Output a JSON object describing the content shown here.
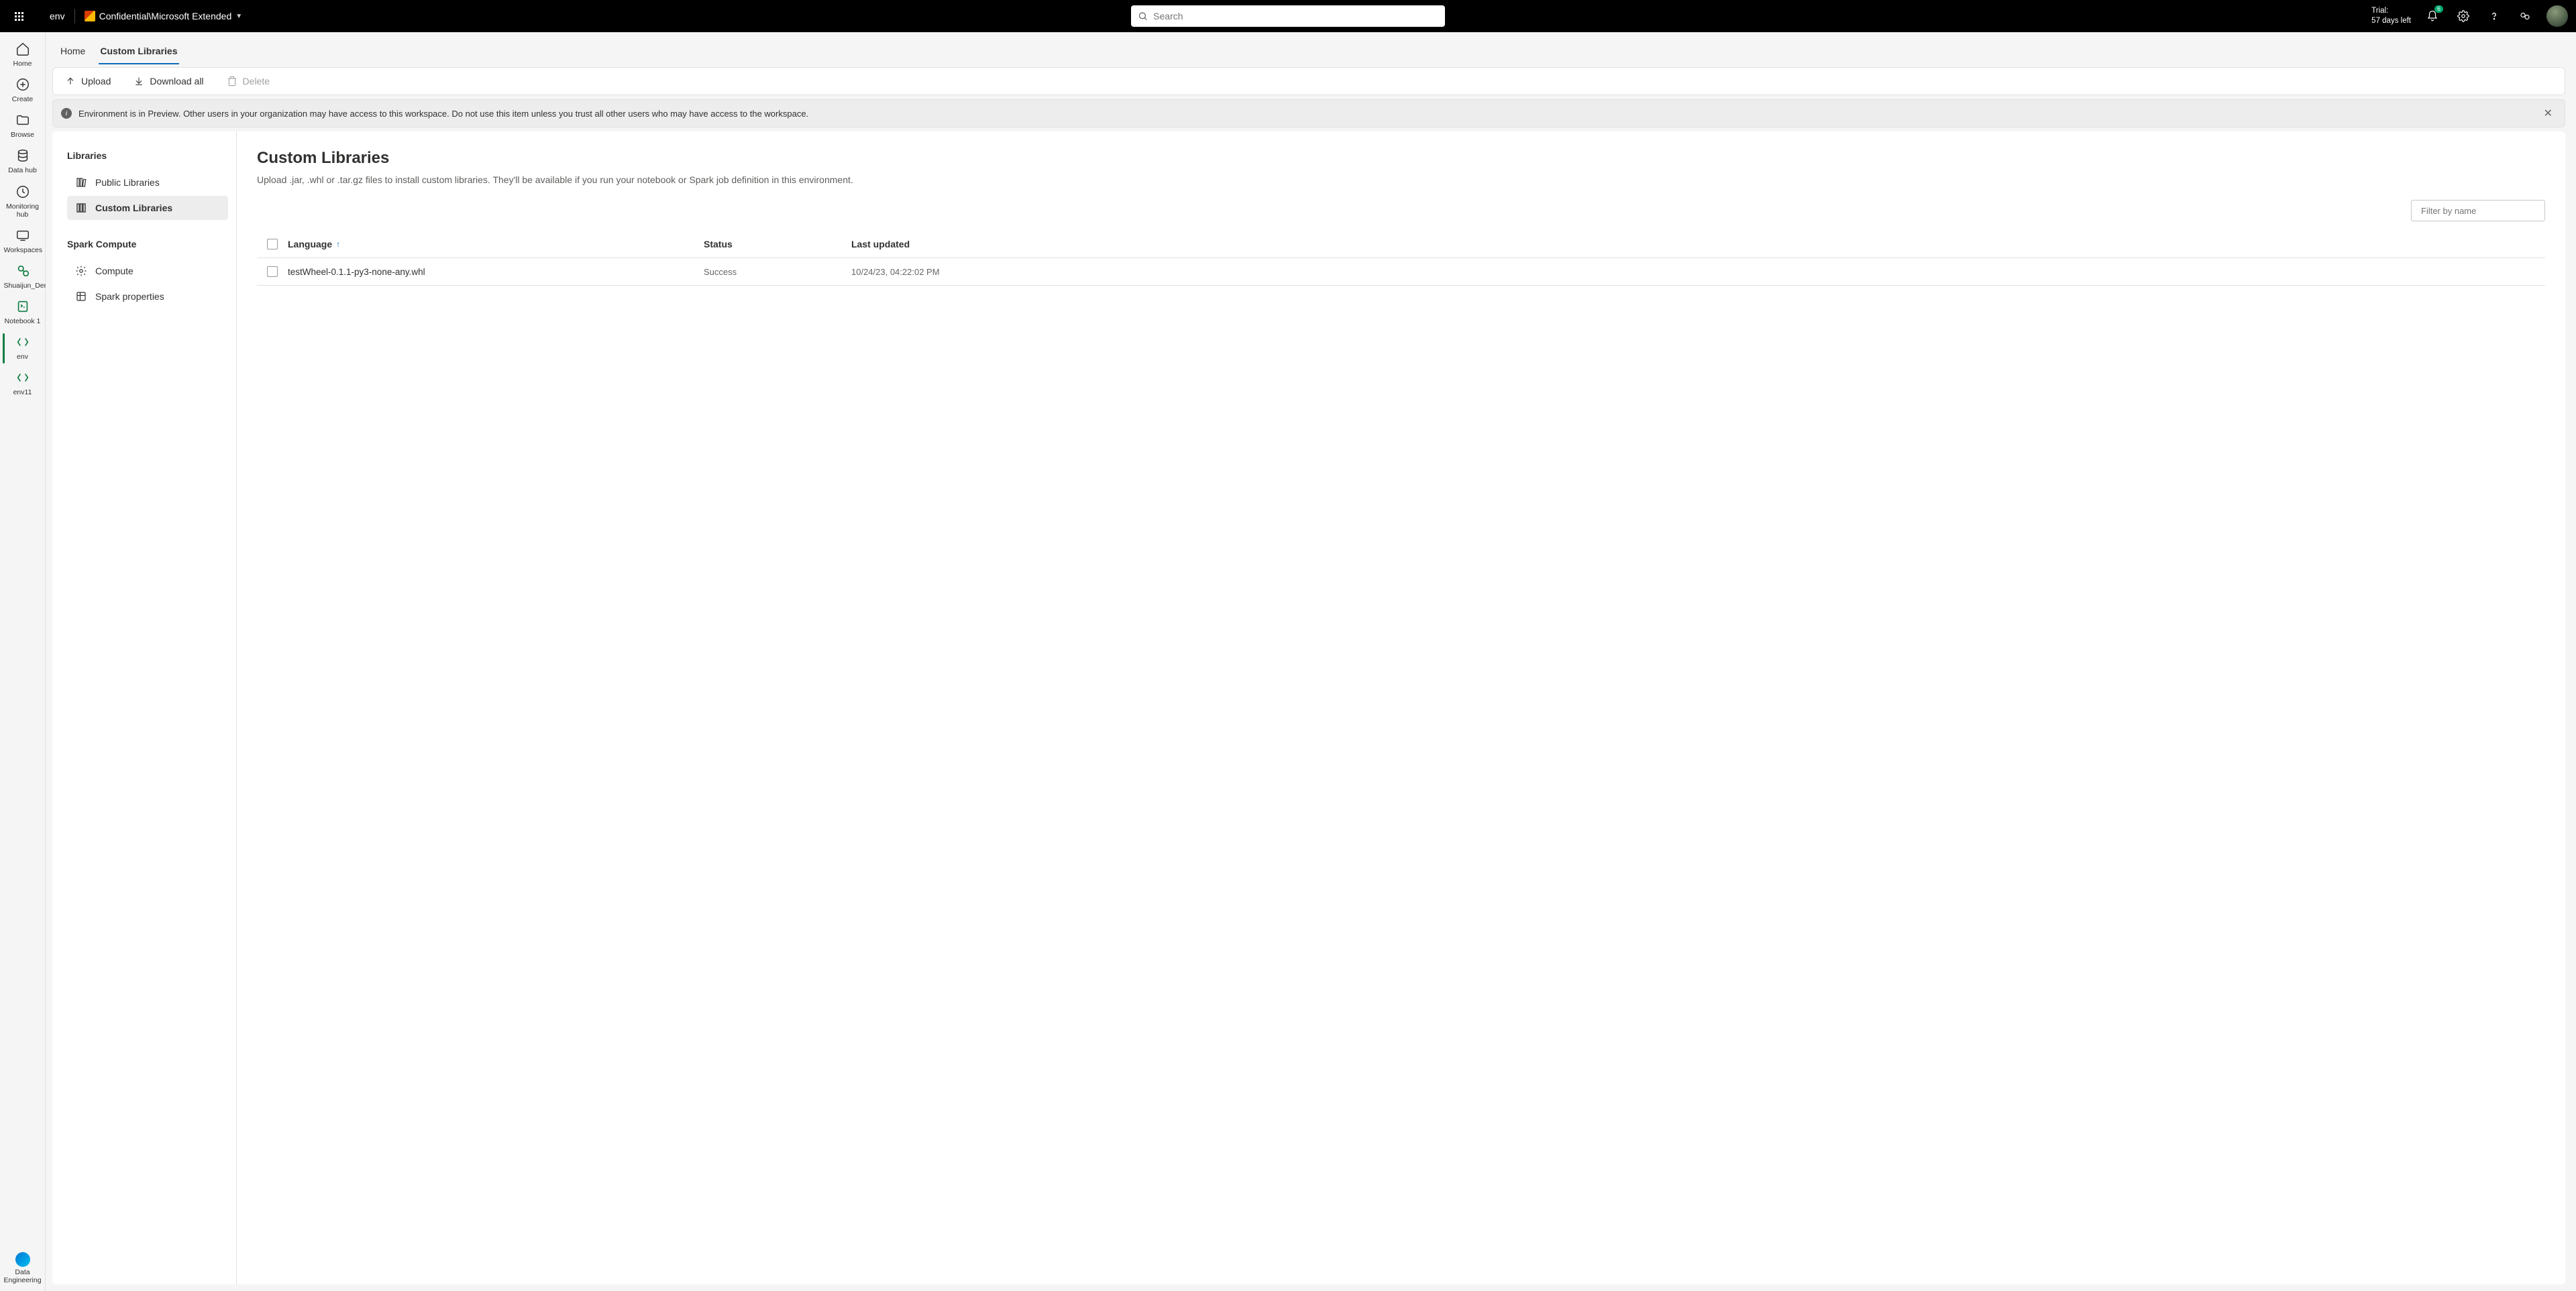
{
  "topbar": {
    "title": "env",
    "sensitivity": "Confidential\\Microsoft Extended",
    "search_placeholder": "Search",
    "trial_label": "Trial:",
    "trial_remaining": "57 days left",
    "notification_count": "6"
  },
  "navrail": {
    "items": [
      {
        "label": "Home"
      },
      {
        "label": "Create"
      },
      {
        "label": "Browse"
      },
      {
        "label": "Data hub"
      },
      {
        "label": "Monitoring hub"
      },
      {
        "label": "Workspaces"
      },
      {
        "label": "Shuaijun_Demo_Env"
      },
      {
        "label": "Notebook 1"
      },
      {
        "label": "env"
      },
      {
        "label": "env11"
      }
    ],
    "bottom": {
      "label": "Data Engineering"
    }
  },
  "tabs": {
    "home": "Home",
    "custom_libraries": "Custom Libraries"
  },
  "toolbar": {
    "upload": "Upload",
    "download": "Download all",
    "delete": "Delete"
  },
  "banner": {
    "text": "Environment is in Preview. Other users in your organization may have access to this workspace. Do not use this item unless you trust all other users who may have access to the workspace."
  },
  "sidebar": {
    "section1": "Libraries",
    "public": "Public Libraries",
    "custom": "Custom Libraries",
    "section2": "Spark Compute",
    "compute": "Compute",
    "spark_props": "Spark properties"
  },
  "content": {
    "title": "Custom Libraries",
    "subtitle": "Upload .jar, .whl or .tar.gz files to install custom libraries. They'll be available if you run your notebook or Spark job definition in this environment.",
    "filter_placeholder": "Filter by name",
    "columns": {
      "language": "Language",
      "status": "Status",
      "updated": "Last updated"
    },
    "rows": [
      {
        "name": "testWheel-0.1.1-py3-none-any.whl",
        "status": "Success",
        "updated": "10/24/23, 04:22:02 PM"
      }
    ]
  }
}
